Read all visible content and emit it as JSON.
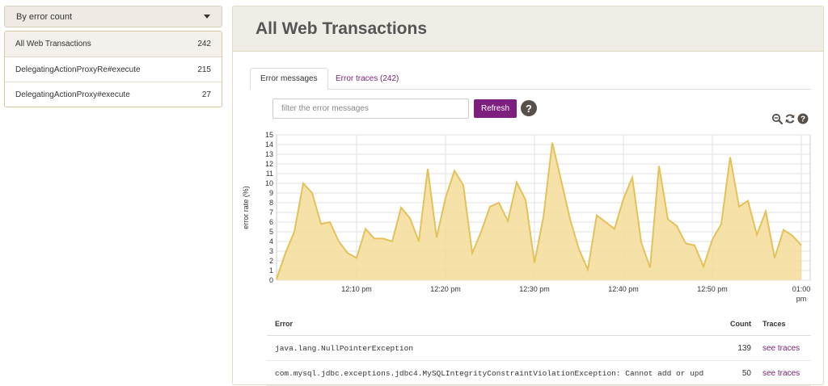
{
  "sidebar": {
    "dropdown_label": "By error count",
    "items": [
      {
        "label": "All Web Transactions",
        "count": "242"
      },
      {
        "label": "DelegatingActionProxyRe#execute",
        "count": "215"
      },
      {
        "label": "DelegatingActionProxy#execute",
        "count": "27"
      }
    ]
  },
  "main": {
    "title": "All Web Transactions",
    "tabs": [
      "Error messages",
      "Error traces (242)"
    ],
    "filter_placeholder": "filter the error messages",
    "refresh_label": "Refresh",
    "help_glyph": "?"
  },
  "colors": {
    "accent": "#7d1f7f",
    "link": "#7b2477",
    "area_fill": "#f5dc9a",
    "area_line": "#e3c25a"
  },
  "chart_data": {
    "type": "area",
    "ylabel": "error rate (%)",
    "ylim": [
      0,
      15
    ],
    "yticks": [
      0,
      1,
      2,
      3,
      4,
      5,
      6,
      7,
      8,
      9,
      10,
      11,
      12,
      13,
      14,
      15
    ],
    "x_start": "12:01",
    "x_end": "13:01",
    "xticks": [
      {
        "t": "12:10",
        "label": "12:10 pm"
      },
      {
        "t": "12:20",
        "label": "12:20 pm"
      },
      {
        "t": "12:30",
        "label": "12:30 pm"
      },
      {
        "t": "12:40",
        "label": "12:40 pm"
      },
      {
        "t": "12:50",
        "label": "12:50 pm"
      },
      {
        "t": "13:00",
        "label": "01:00\npm"
      }
    ],
    "grid": true,
    "points": [
      [
        "12:01",
        0.1
      ],
      [
        "12:02",
        2.8
      ],
      [
        "12:03",
        5.0
      ],
      [
        "12:04",
        10.0
      ],
      [
        "12:05",
        9.0
      ],
      [
        "12:06",
        5.8
      ],
      [
        "12:07",
        6.0
      ],
      [
        "12:08",
        4.0
      ],
      [
        "12:09",
        2.8
      ],
      [
        "12:10",
        2.3
      ],
      [
        "12:11",
        5.3
      ],
      [
        "12:12",
        4.3
      ],
      [
        "12:13",
        4.3
      ],
      [
        "12:14",
        4.0
      ],
      [
        "12:15",
        7.5
      ],
      [
        "12:16",
        6.4
      ],
      [
        "12:17",
        4.0
      ],
      [
        "12:18",
        11.5
      ],
      [
        "12:19",
        4.4
      ],
      [
        "12:20",
        8.5
      ],
      [
        "12:21",
        11.3
      ],
      [
        "12:22",
        9.8
      ],
      [
        "12:23",
        2.8
      ],
      [
        "12:24",
        5.0
      ],
      [
        "12:25",
        7.6
      ],
      [
        "12:26",
        8.0
      ],
      [
        "12:27",
        6.1
      ],
      [
        "12:28",
        10.1
      ],
      [
        "12:29",
        8.3
      ],
      [
        "12:30",
        1.8
      ],
      [
        "12:31",
        6.5
      ],
      [
        "12:32",
        14.2
      ],
      [
        "12:33",
        10.3
      ],
      [
        "12:34",
        6.3
      ],
      [
        "12:35",
        3.2
      ],
      [
        "12:36",
        1.1
      ],
      [
        "12:37",
        6.7
      ],
      [
        "12:38",
        6.0
      ],
      [
        "12:39",
        5.3
      ],
      [
        "12:40",
        8.4
      ],
      [
        "12:41",
        10.6
      ],
      [
        "12:42",
        3.9
      ],
      [
        "12:43",
        1.3
      ],
      [
        "12:44",
        11.8
      ],
      [
        "12:45",
        6.3
      ],
      [
        "12:46",
        5.6
      ],
      [
        "12:47",
        3.8
      ],
      [
        "12:48",
        3.6
      ],
      [
        "12:49",
        1.4
      ],
      [
        "12:50",
        4.2
      ],
      [
        "12:51",
        5.8
      ],
      [
        "12:52",
        12.7
      ],
      [
        "12:53",
        7.6
      ],
      [
        "12:54",
        8.2
      ],
      [
        "12:55",
        4.7
      ],
      [
        "12:56",
        7.1
      ],
      [
        "12:57",
        2.3
      ],
      [
        "12:58",
        5.2
      ],
      [
        "12:59",
        4.6
      ],
      [
        "13:00",
        3.6
      ]
    ]
  },
  "errors_table": {
    "headers": {
      "error": "Error",
      "count": "Count",
      "traces": "Traces"
    },
    "rows": [
      {
        "error": "java.lang.NullPointerException",
        "count": "139",
        "traces": "see traces"
      },
      {
        "error": "com.mysql.jdbc.exceptions.jdbc4.MySQLIntegrityConstraintViolationException: Cannot add or upd",
        "count": "50",
        "traces": "see traces"
      }
    ]
  }
}
